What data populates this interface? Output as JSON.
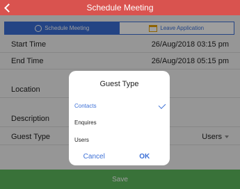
{
  "header": {
    "title": "Schedule Meeting"
  },
  "tabs": [
    {
      "label": "Schedule Meeting",
      "icon": "clock-icon",
      "active": true
    },
    {
      "label": "Leave Application",
      "icon": "calendar-icon",
      "active": false
    }
  ],
  "form": {
    "start_time": {
      "label": "Start Time",
      "value": "26/Aug/2018 03:15 pm"
    },
    "end_time": {
      "label": "End Time",
      "value": "26/Aug/2018 05:15 pm"
    },
    "location": {
      "label": "Location"
    },
    "description": {
      "label": "Description"
    },
    "guest_type": {
      "label": "Guest Type",
      "value": "Users"
    }
  },
  "save_label": "Save",
  "dialog": {
    "title": "Guest Type",
    "options": [
      "Contacts",
      "Enquires",
      "Users"
    ],
    "selected_option": "Contacts",
    "cancel_label": "Cancel",
    "ok_label": "OK"
  },
  "colors": {
    "header": "#d9534f",
    "accent": "#3b6fd6",
    "save": "#5cb85c"
  }
}
